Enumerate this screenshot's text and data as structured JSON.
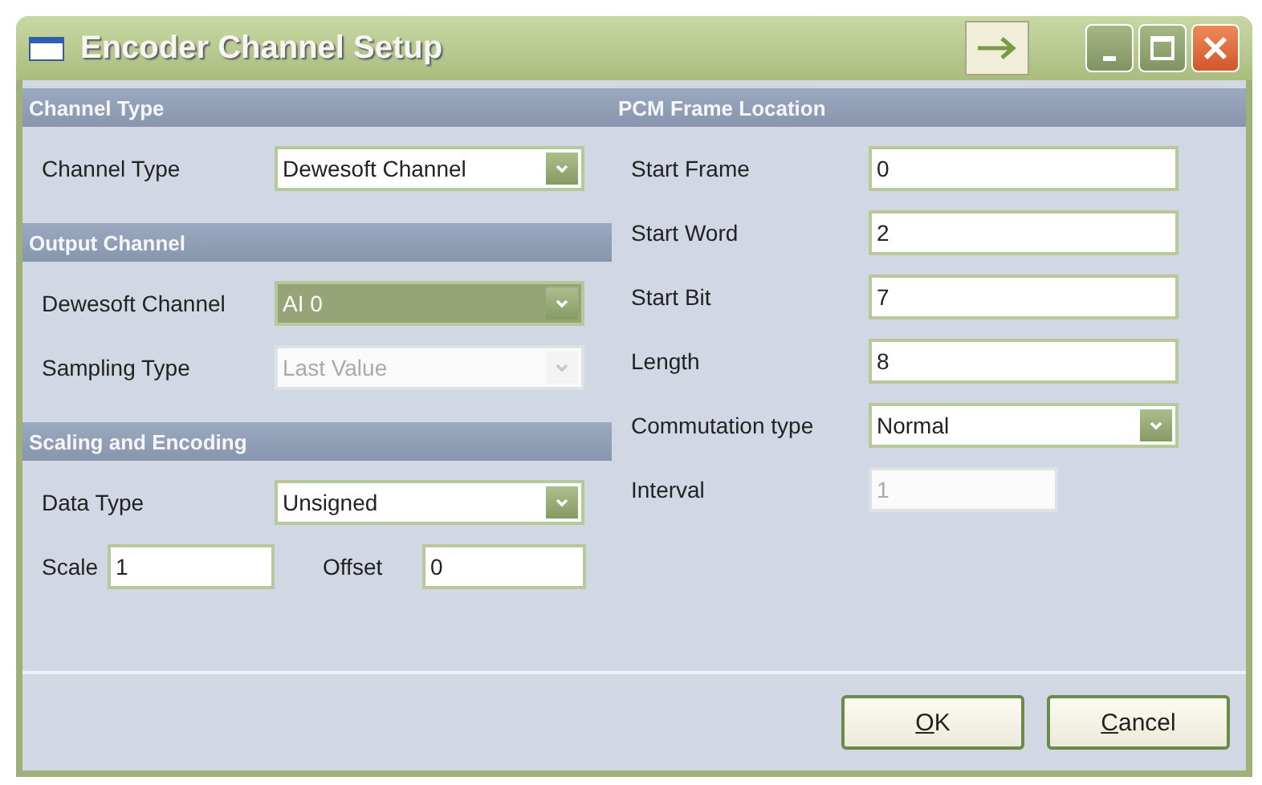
{
  "window": {
    "title": "Encoder Channel Setup"
  },
  "left_sections": [
    {
      "header": "Channel Type",
      "rows": [
        {
          "kind": "combo",
          "label": "Channel Type",
          "value": "Dewesoft Channel",
          "disabled": false,
          "selected": false
        }
      ]
    },
    {
      "header": "Output Channel",
      "rows": [
        {
          "kind": "combo",
          "label": "Dewesoft Channel",
          "value": "AI 0",
          "disabled": false,
          "selected": true
        },
        {
          "kind": "combo",
          "label": "Sampling Type",
          "value": "Last Value",
          "disabled": true,
          "selected": false
        }
      ]
    },
    {
      "header": "Scaling and Encoding",
      "rows": [
        {
          "kind": "combo",
          "label": "Data Type",
          "value": "Unsigned",
          "disabled": false,
          "selected": false
        },
        {
          "kind": "pair",
          "label": "Scale",
          "value": "1",
          "label2": "Offset",
          "value2": "0"
        }
      ]
    }
  ],
  "right_section": {
    "header": "PCM Frame Location",
    "rows": [
      {
        "kind": "text",
        "label": "Start Frame",
        "value": "0",
        "disabled": false
      },
      {
        "kind": "text",
        "label": "Start Word",
        "value": "2",
        "disabled": false
      },
      {
        "kind": "text",
        "label": "Start Bit",
        "value": "7",
        "disabled": false
      },
      {
        "kind": "text",
        "label": "Length",
        "value": "8",
        "disabled": false
      },
      {
        "kind": "combo",
        "label": "Commutation type",
        "value": "Normal",
        "disabled": false
      },
      {
        "kind": "short",
        "label": "Interval",
        "value": "1",
        "disabled": true
      }
    ]
  },
  "buttons": [
    {
      "accel": "O",
      "label": "K"
    },
    {
      "accel": "C",
      "label": "ancel"
    }
  ]
}
